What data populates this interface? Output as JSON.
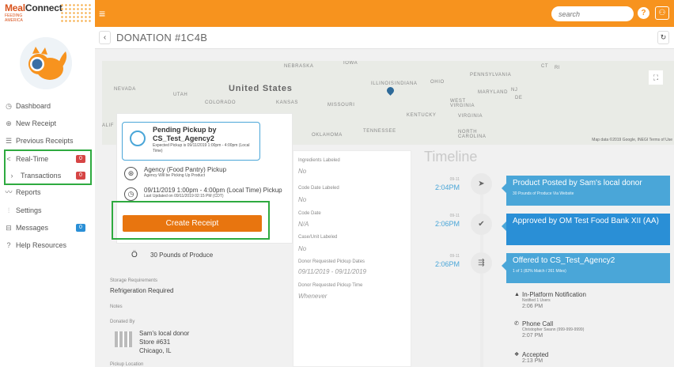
{
  "brand": {
    "name_a": "Meal",
    "name_b": "Connect",
    "sub_a": "FEEDING",
    "sub_b": "AMERICA"
  },
  "header": {
    "menu_icon": "menu-icon",
    "search_placeholder": "search",
    "help": "?",
    "user_icon": "user-icon"
  },
  "sidebar": {
    "items": [
      {
        "label": "Dashboard",
        "icon": "clock-icon"
      },
      {
        "label": "New Receipt",
        "icon": "plus-circle-icon"
      },
      {
        "label": "Previous Receipts",
        "icon": "list-icon"
      },
      {
        "label": "Real-Time",
        "icon": "share-icon",
        "badge": "0"
      },
      {
        "label": "Transactions",
        "icon": "chevron-right-icon",
        "badge": "0"
      },
      {
        "label": "Reports",
        "icon": "chart-line-icon"
      },
      {
        "label": "Settings",
        "icon": "sliders-icon"
      },
      {
        "label": "Messages",
        "icon": "inbox-icon",
        "badge": "0"
      },
      {
        "label": "Help Resources",
        "icon": "question-circle-icon"
      }
    ]
  },
  "page": {
    "back": "‹",
    "title": "DONATION #1C4B",
    "refresh": "↻"
  },
  "map": {
    "labels": {
      "nebraska": "NEBRASKA",
      "iowa": "IOWA",
      "nevada": "NEVADA",
      "utah": "UTAH",
      "colorado": "COLORADO",
      "us": "United States",
      "kansas": "KANSAS",
      "missouri": "MISSOURI",
      "illinois": "ILLINOIS",
      "indiana": "INDIANA",
      "ohio": "OHIO",
      "pennsylvania": "PENNSYLVANIA",
      "ct": "CT",
      "ri": "RI",
      "maryland": "MARYLAND",
      "nj": "NJ",
      "de": "DE",
      "westvirginia": "WEST VIRGINIA",
      "virginia": "VIRGINIA",
      "kentucky": "KENTUCKY",
      "tennessee": "TENNESSEE",
      "northcarolina": "NORTH CAROLINA",
      "oklahoma": "OKLAHOMA",
      "alif": "ALIF"
    },
    "attribution": "Map data ©2019 Google, INEGI   Terms of Use"
  },
  "status": {
    "pending_title": "Pending Pickup by CS_Test_Agency2",
    "pending_sub": "Expected Pickup is 09/11/2019 1:00pm - 4:00pm (Local Time)",
    "agency_title": "Agency (Food Pantry) Pickup",
    "agency_sub": "Agency Will be Picking Up Product",
    "time_title": "09/11/2019 1:00pm - 4:00pm (Local Time) Pickup",
    "time_sub": "Last Updated on 09/11/2019 02:15 PM (CDT)",
    "create_button": "Create Receipt",
    "produce": "30 Pounds of Produce"
  },
  "left_fields": {
    "storage_label": "Storage Requirements",
    "storage_value": "Refrigeration Required",
    "notes_label": "Notes",
    "donated_label": "Donated By",
    "donor_name": "Sam's local donor",
    "donor_store": "Store #631",
    "donor_city": "Chicago, IL",
    "pickup_label": "Pickup Location"
  },
  "details": [
    {
      "label": "Ingredients Labeled",
      "value": "No"
    },
    {
      "label": "Code Date Labeled",
      "value": "No"
    },
    {
      "label": "Code Date",
      "value": "N/A"
    },
    {
      "label": "Case/Unit Labeled",
      "value": "No"
    },
    {
      "label": "Donor Requested Pickup Dates",
      "value": "09/11/2019 - 09/11/2019"
    },
    {
      "label": "Donor Requested Pickup Time",
      "value": "Whenever"
    }
  ],
  "timeline": {
    "title": "Timeline",
    "events": [
      {
        "date": "09-11",
        "time": "2:04PM",
        "icon": "send-icon",
        "title": "Product Posted by Sam's local donor",
        "sub": "30 Pounds of Produce Via Website"
      },
      {
        "date": "09-11",
        "time": "2:06PM",
        "icon": "check-icon",
        "title": "Approved by OM Test Food Bank XII (AA)",
        "sub": ""
      },
      {
        "date": "09-11",
        "time": "2:06PM",
        "icon": "routing-icon",
        "title": "Offered to CS_Test_Agency2",
        "sub": "1 of 1 (82% Match / 261 Miles)"
      }
    ],
    "notifications": [
      {
        "icon": "bell-icon",
        "title": "In-Platform Notification",
        "sub": "Notified 1 Users",
        "time": "2:06 PM"
      },
      {
        "icon": "phone-icon",
        "title": "Phone Call",
        "sub": "Christopher Swann (999-999-9999)",
        "time": "2:07 PM"
      },
      {
        "icon": "handshake-icon",
        "title": "Accepted",
        "sub": "",
        "time": "2:13 PM"
      }
    ]
  },
  "colors": {
    "accent": "#f7931e",
    "button": "#e8750f",
    "timeline": "#4aa6d8",
    "highlight": "#2eaa3f"
  }
}
